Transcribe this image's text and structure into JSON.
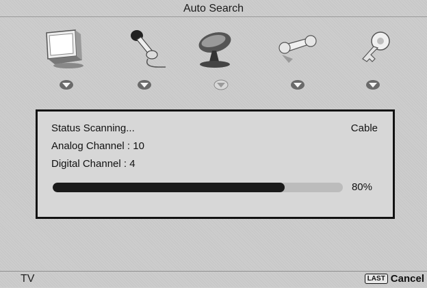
{
  "header": {
    "title": "Auto Search"
  },
  "menu": {
    "icons": [
      {
        "name": "picture-icon"
      },
      {
        "name": "audio-icon"
      },
      {
        "name": "channel-icon"
      },
      {
        "name": "setup-icon"
      },
      {
        "name": "lock-icon"
      }
    ]
  },
  "status": {
    "line1": "Status Scanning...",
    "signal": "Cable",
    "analog": "Analog Channel : 10",
    "digital": "Digital Channel : 4",
    "progress_percent": 80,
    "progress_text": "80%"
  },
  "footer": {
    "source": "TV",
    "key_badge": "LAST",
    "key_action": "Cancel"
  },
  "colors": {
    "background": "#cdcdcd",
    "progress_fill": "#1a1a1a",
    "border": "#111111"
  }
}
